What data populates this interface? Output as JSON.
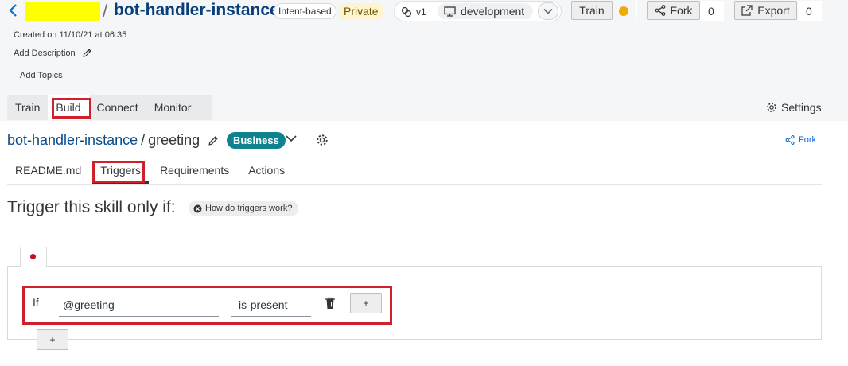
{
  "header": {
    "back_icon": "chevron-left-icon",
    "slash": "/",
    "bot_name": "bot-handler-instance",
    "bot_type_badge": "Intent-based",
    "visibility_badge": "Private",
    "version": "v1",
    "environment": "development",
    "train_label": "Train",
    "train_status_color": "#f0ab00",
    "fork_label": "Fork",
    "fork_count": "0",
    "export_label": "Export",
    "export_count": "0",
    "created": "Created on 11/10/21 at 06:35",
    "add_description": "Add Description",
    "add_topics": "Add Topics"
  },
  "main_tabs": [
    {
      "label": "Train"
    },
    {
      "label": "Build",
      "active": true
    },
    {
      "label": "Connect"
    },
    {
      "label": "Monitor"
    }
  ],
  "settings_label": "Settings",
  "skill": {
    "bot_link": "bot-handler-instance",
    "separator": "/",
    "name": "greeting",
    "type_badge": "Business",
    "type_badge_color": "#0f828f",
    "fork_label": "Fork"
  },
  "sub_tabs": [
    {
      "label": "README.md"
    },
    {
      "label": "Triggers",
      "active": true
    },
    {
      "label": "Requirements"
    },
    {
      "label": "Actions"
    }
  ],
  "triggers": {
    "heading": "Trigger this skill only if:",
    "help_label": "How do triggers work?",
    "condition": {
      "if_label": "If",
      "entity_value": "@greeting",
      "operator_value": "is-present",
      "add_inner_label": "+"
    },
    "add_outer_label": "+"
  },
  "colors": {
    "highlight": "#d0202c",
    "link": "#0a4c8c",
    "accent": "#0a6ed1"
  }
}
